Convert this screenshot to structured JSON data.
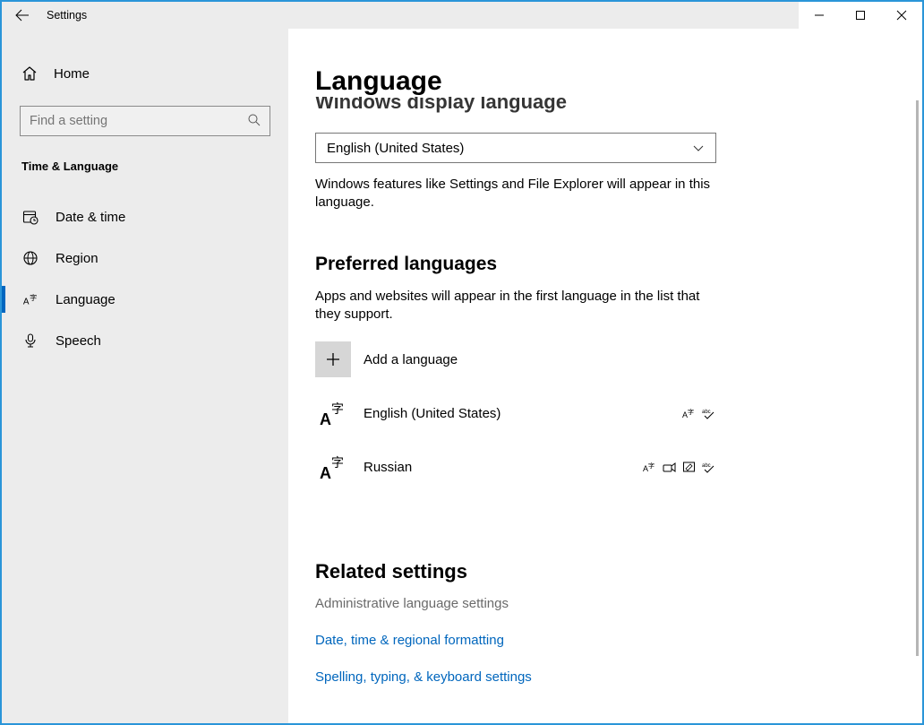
{
  "titlebar": {
    "title": "Settings"
  },
  "sidebar": {
    "home": "Home",
    "search_placeholder": "Find a setting",
    "category": "Time & Language",
    "items": [
      {
        "label": "Date & time"
      },
      {
        "label": "Region"
      },
      {
        "label": "Language"
      },
      {
        "label": "Speech"
      }
    ]
  },
  "main": {
    "page_title": "Language",
    "display_heading": "Windows display language",
    "display_selected": "English (United States)",
    "display_desc": "Windows features like Settings and File Explorer will appear in this language.",
    "preferred_heading": "Preferred languages",
    "preferred_desc": "Apps and websites will appear in the first language in the list that they support.",
    "add_label": "Add a language",
    "languages": [
      {
        "name": "English (United States)",
        "features": [
          "display-pack",
          "spellcheck"
        ]
      },
      {
        "name": "Russian",
        "features": [
          "display-pack",
          "text-to-speech",
          "handwriting",
          "spellcheck"
        ]
      }
    ],
    "related_heading": "Related settings",
    "related_gray": "Administrative language settings",
    "related_links": [
      "Date, time & regional formatting",
      "Spelling, typing, & keyboard settings"
    ]
  }
}
